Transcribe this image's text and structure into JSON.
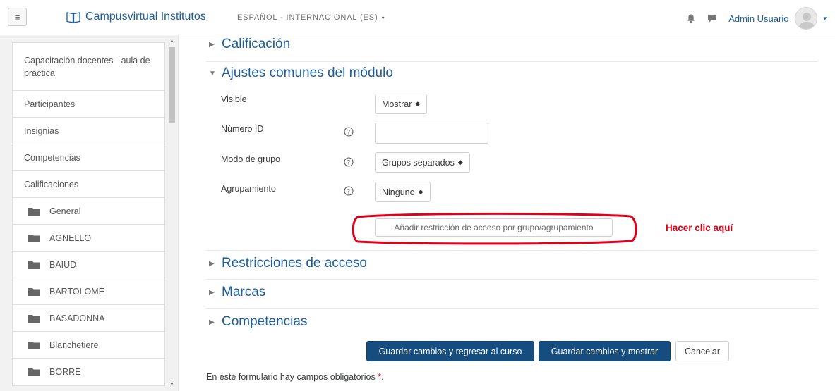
{
  "navbar": {
    "brand": "Campusvirtual Institutos",
    "language": "ESPAÑOL - INTERNACIONAL (ES)",
    "user_name": "Admin Usuario",
    "icons": [
      "menu-icon",
      "book-icon",
      "bell-icon",
      "chat-icon",
      "avatar-icon"
    ]
  },
  "sidebar": {
    "items": [
      {
        "label": "Capacitación docentes - aula de práctica"
      },
      {
        "label": "Participantes"
      },
      {
        "label": "Insignias"
      },
      {
        "label": "Competencias"
      },
      {
        "label": "Calificaciones"
      },
      {
        "label": "General"
      },
      {
        "label": "AGNELLO"
      },
      {
        "label": "BAIUD"
      },
      {
        "label": "BARTOLOMÉ"
      },
      {
        "label": "BASADONNA"
      },
      {
        "label": "Blanchetiere"
      },
      {
        "label": "BORRE"
      }
    ]
  },
  "sections": {
    "calificacion": "Calificación",
    "ajustes": "Ajustes comunes del módulo",
    "restricciones": "Restricciones de acceso",
    "marcas": "Marcas",
    "competencias": "Competencias"
  },
  "form": {
    "visible_label": "Visible",
    "visible_value": "Mostrar",
    "numero_id_label": "Número ID",
    "numero_id_value": "",
    "modo_grupo_label": "Modo de grupo",
    "modo_grupo_value": "Grupos separados",
    "agrupamiento_label": "Agrupamiento",
    "agrupamiento_value": "Ninguno",
    "restrict_button": "Añadir restricción de acceso por grupo/agrupamiento",
    "annotation": "Hacer clic aquí"
  },
  "buttons": {
    "save_return": "Guardar cambios y regresar al curso",
    "save_show": "Guardar cambios y mostrar",
    "cancel": "Cancelar"
  },
  "footer": {
    "required_note": "En este formulario hay campos obligatorios",
    "required_star": "*",
    "required_period": "."
  },
  "colors": {
    "brand_blue": "#1d5e9a",
    "primary_button": "#164d80",
    "annotation_red": "#e0001a"
  }
}
